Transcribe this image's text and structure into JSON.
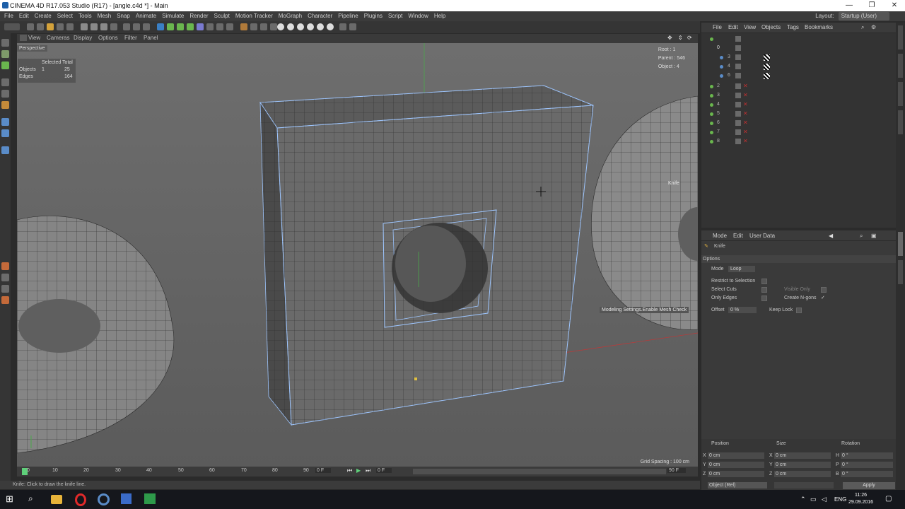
{
  "window": {
    "title": "CINEMA 4D R17.053 Studio (R17) - [angle.c4d *] - Main",
    "controls": [
      "—",
      "❐",
      "✕"
    ]
  },
  "menubar": {
    "items": [
      "File",
      "Edit",
      "Create",
      "Select",
      "Tools",
      "Mesh",
      "Snap",
      "Animate",
      "Simulate",
      "Render",
      "Sculpt",
      "Motion Tracker",
      "MoGraph",
      "Character",
      "Pipeline",
      "Plugins",
      "Script",
      "Window",
      "Help"
    ],
    "layout_label": "Layout:",
    "layout_value": "Startup (User)"
  },
  "viewport": {
    "menu": [
      "View",
      "Cameras",
      "Display",
      "Options",
      "Filter",
      "Panel"
    ],
    "name": "Perspective",
    "stats": {
      "header": "Selected Total",
      "objects_label": "Objects",
      "objects_selected": "1",
      "objects_total": "25",
      "edges_label": "Edges",
      "edges_total": "164"
    },
    "info": {
      "root": "Root : 1",
      "parent": "Parent : 546",
      "object": "Object : 4"
    },
    "tooltip": "Modeling Settings.Enable Mesh Check",
    "cursor_label": "Knife",
    "grid_spacing": "Grid Spacing : 100 cm"
  },
  "timeline": {
    "ticks": [
      "0",
      "10",
      "20",
      "30",
      "40",
      "50",
      "60",
      "70",
      "80",
      "90"
    ],
    "frame_start": "0 F",
    "frame_current": "0 F",
    "frame_end": "90 F"
  },
  "statusbar": {
    "text": "Knife: Click to draw the knife line."
  },
  "object_manager": {
    "menu": [
      "File",
      "Edit",
      "View",
      "Objects",
      "Tags",
      "Bookmarks"
    ],
    "rows": [
      {
        "num": "",
        "indent": 0
      },
      {
        "num": "0",
        "indent": 1
      },
      {
        "num": "3",
        "indent": 2
      },
      {
        "num": "4",
        "indent": 2
      },
      {
        "num": "6",
        "indent": 2
      },
      {
        "num": "2",
        "indent": 0
      },
      {
        "num": "3",
        "indent": 0
      },
      {
        "num": "4",
        "indent": 0
      },
      {
        "num": "5",
        "indent": 0
      },
      {
        "num": "6",
        "indent": 0
      },
      {
        "num": "7",
        "indent": 0
      },
      {
        "num": "8",
        "indent": 0
      }
    ]
  },
  "attribute_manager": {
    "menu": [
      "Mode",
      "Edit",
      "User Data"
    ],
    "tool_name": "Knife",
    "section": "Options",
    "mode_label": "Mode",
    "mode_value": "Loop",
    "restrict_label": "Restrict to Selection",
    "select_cuts_label": "Select Cuts",
    "visible_only_label": "Visible Only",
    "only_edges_label": "Only Edges",
    "create_ngons_label": "Create N-gons",
    "create_ngons_check": "✓",
    "offset_label": "Offset",
    "offset_value": "0 %",
    "keep_lock_label": "Keep Lock"
  },
  "coordinates": {
    "headers": [
      "Position",
      "Size",
      "Rotation"
    ],
    "rows": [
      {
        "axis": "X",
        "pos": "0 cm",
        "size_axis": "X",
        "size": "0 cm",
        "rot_axis": "H",
        "rot": "0 °"
      },
      {
        "axis": "Y",
        "pos": "0 cm",
        "size_axis": "Y",
        "size": "0 cm",
        "rot_axis": "P",
        "rot": "0 °"
      },
      {
        "axis": "Z",
        "pos": "0 cm",
        "size_axis": "Z",
        "size": "0 cm",
        "rot_axis": "B",
        "rot": "0 °"
      }
    ],
    "mode": "Object (Rel)",
    "apply": "Apply"
  },
  "taskbar": {
    "language": "ENG",
    "time": "11:26",
    "date": "29.09.2016"
  }
}
